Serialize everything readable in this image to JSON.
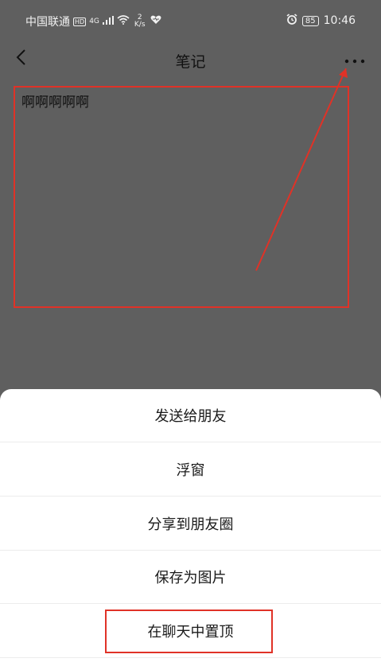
{
  "status_bar": {
    "carrier": "中国联通",
    "hd": "HD",
    "network": "4G",
    "speed_value": "2",
    "speed_unit": "K/s",
    "battery": "85",
    "time": "10:46",
    "icons": [
      "hd-icon",
      "signal-icon",
      "wifi-icon",
      "heart-icon",
      "alarm-icon",
      "battery-icon"
    ]
  },
  "header": {
    "title": "笔记",
    "back_icon": "chevron-left-icon",
    "more_icon": "more-dots-icon"
  },
  "note": {
    "content": "啊啊啊啊啊"
  },
  "action_sheet": {
    "items": [
      {
        "label": "发送给朋友"
      },
      {
        "label": "浮窗"
      },
      {
        "label": "分享到朋友圈"
      },
      {
        "label": "保存为图片"
      },
      {
        "label": "在聊天中置顶"
      }
    ]
  },
  "annotation": {
    "color": "#e03227"
  }
}
